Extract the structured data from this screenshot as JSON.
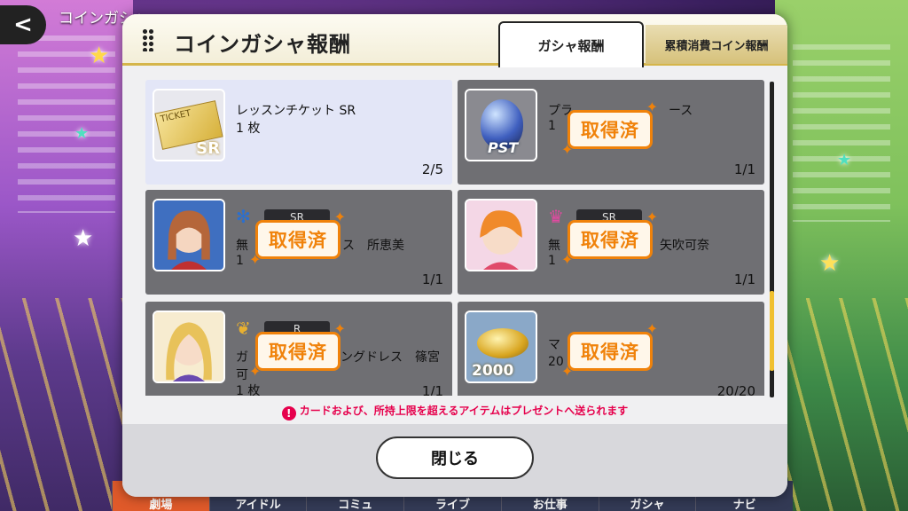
{
  "screen": {
    "title": "コインガシャ"
  },
  "bottom_nav": [
    "劇場",
    "アイドル",
    "コミュ",
    "ライブ",
    "お仕事",
    "ガシャ",
    "ナビ"
  ],
  "modal": {
    "title": "コインガシャ報酬",
    "tabs": [
      "ガシャ報酬",
      "累積消費コイン報酬"
    ],
    "claimed_stamp": "取得済",
    "items": [
      {
        "name": "レッスンチケット SR",
        "qty": "1 枚",
        "count": "2/5",
        "claimed": false,
        "thumb_text": "TICKET",
        "thumb_badge": "SR"
      },
      {
        "name": "プラ",
        "name_tail": "ース",
        "qty": "1",
        "count": "1/1",
        "claimed": true,
        "thumb_badge": "PST"
      },
      {
        "name": "無",
        "name_tail": "ス　所恵美",
        "qty": "1",
        "count": "1/1",
        "claimed": true,
        "rarity": "SR"
      },
      {
        "name": "無",
        "name_tail": "矢吹可奈",
        "qty": "1",
        "count": "1/1",
        "claimed": true,
        "rarity": "SR"
      },
      {
        "name": "ガ",
        "name_tail": "ングドレス　篠宮",
        "name_line2": "可",
        "qty": "1 枚",
        "count": "1/1",
        "claimed": true,
        "rarity": "R"
      },
      {
        "name": "マ",
        "qty": "20",
        "count": "20/20",
        "claimed": true,
        "thumb_badge": "2000"
      }
    ],
    "notice": "カードおよび、所持上限を超えるアイテムはプレゼントへ送られます",
    "close_label": "閉じる"
  },
  "colors": {
    "accent": "#f0820a",
    "notice": "#e6004c",
    "header_border": "#d5b54a"
  }
}
